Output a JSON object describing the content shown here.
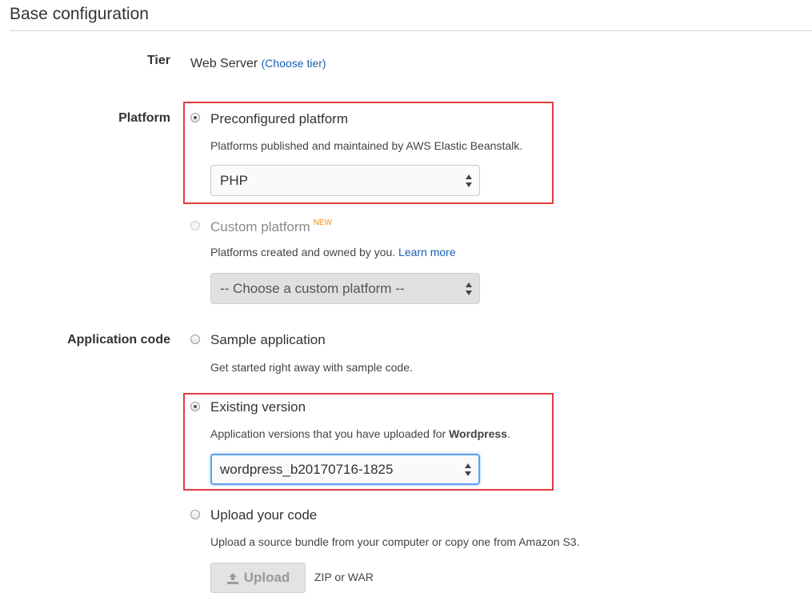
{
  "section_title": "Base configuration",
  "tier": {
    "label": "Tier",
    "value": "Web Server",
    "link": "(Choose tier)"
  },
  "platform": {
    "label": "Platform",
    "preconfigured": {
      "title": "Preconfigured platform",
      "description": "Platforms published and maintained by AWS Elastic Beanstalk.",
      "selected_value": "PHP"
    },
    "custom": {
      "title": "Custom platform",
      "badge": "NEW",
      "description": "Platforms created and owned by you.",
      "learn_more": "Learn more",
      "selected_value": "-- Choose a custom platform --"
    }
  },
  "application_code": {
    "label": "Application code",
    "sample": {
      "title": "Sample application",
      "description": "Get started right away with sample code."
    },
    "existing": {
      "title": "Existing version",
      "description_prefix": "Application versions that you have uploaded for ",
      "app_name": "Wordpress",
      "description_suffix": ".",
      "selected_value": "wordpress_b20170716-1825"
    },
    "upload": {
      "title": "Upload your code",
      "description": "Upload a source bundle from your computer or copy one from Amazon S3.",
      "button_label": "Upload",
      "hint": "ZIP or WAR"
    }
  },
  "colors": {
    "highlight": "#e23c3c",
    "link": "#1a5fb4",
    "badge": "#f08a1c",
    "focus": "#5ea0f0"
  }
}
